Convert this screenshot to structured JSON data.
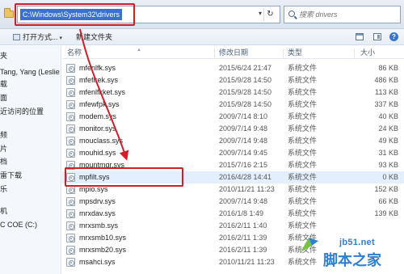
{
  "address": {
    "path": "C:\\Windows\\System32\\drivers",
    "dropdown_glyph": "▾",
    "refresh_glyph": "↻"
  },
  "search": {
    "placeholder": "搜索 drivers"
  },
  "toolbar": {
    "open_label": "打开方式...",
    "open_caret": "▾",
    "new_folder_label": "新建文件夹",
    "help_glyph": "?"
  },
  "nav": {
    "items": [
      "夹",
      "Tang, Yang (Leslie",
      "载",
      "面",
      "近访问的位置",
      "",
      "频",
      "片",
      "档",
      "雷下载",
      "乐",
      "",
      "机",
      "C COE (C:)"
    ]
  },
  "columns": {
    "name": "名称",
    "date": "修改日期",
    "type": "类型",
    "size": "大小"
  },
  "files": [
    {
      "name": "mfenlfk.sys",
      "date": "2015/6/24 21:47",
      "type": "系统文件",
      "size": "86 KB"
    },
    {
      "name": "mfefirek.sys",
      "date": "2015/9/28 14:50",
      "type": "系统文件",
      "size": "486 KB"
    },
    {
      "name": "mfenlfkket.sys",
      "date": "2015/9/28 14:50",
      "type": "系统文件",
      "size": "113 KB"
    },
    {
      "name": "mfewfpk.sys",
      "date": "2015/9/28 14:50",
      "type": "系统文件",
      "size": "337 KB"
    },
    {
      "name": "modem.sys",
      "date": "2009/7/14 8:10",
      "type": "系统文件",
      "size": "40 KB"
    },
    {
      "name": "monitor.sys",
      "date": "2009/7/14 9:48",
      "type": "系统文件",
      "size": "24 KB"
    },
    {
      "name": "mouclass.sys",
      "date": "2009/7/14 9:48",
      "type": "系统文件",
      "size": "49 KB"
    },
    {
      "name": "mouhid.sys",
      "date": "2009/7/14 9:45",
      "type": "系统文件",
      "size": "31 KB"
    },
    {
      "name": "mountmgr.sys",
      "date": "2015/7/16 2:15",
      "type": "系统文件",
      "size": "93 KB"
    },
    {
      "name": "mpfilt.sys",
      "date": "2016/4/28 14:41",
      "type": "系统文件",
      "size": "0 KB"
    },
    {
      "name": "mpio.sys",
      "date": "2010/11/21 11:23",
      "type": "系统文件",
      "size": "152 KB"
    },
    {
      "name": "mpsdrv.sys",
      "date": "2009/7/14 9:48",
      "type": "系统文件",
      "size": "66 KB"
    },
    {
      "name": "mrxdav.sys",
      "date": "2016/1/8 1:49",
      "type": "系统文件",
      "size": "139 KB"
    },
    {
      "name": "mrxsmb.sys",
      "date": "2016/2/11 1:40",
      "type": "系统文件",
      "size": ""
    },
    {
      "name": "mrxsmb10.sys",
      "date": "2016/2/11 1:39",
      "type": "系统文件",
      "size": ""
    },
    {
      "name": "mrxsmb20.sys",
      "date": "2016/2/11 1:39",
      "type": "系统文件",
      "size": ""
    },
    {
      "name": "msahci.sys",
      "date": "2010/11/21 11:23",
      "type": "系统文件",
      "size": ""
    }
  ],
  "watermark": {
    "url": "jb51.net",
    "text": "脚本之家"
  },
  "colors": {
    "annotation_red": "#d11f2a",
    "address_highlight": "#3b6fd0",
    "selected_row": "#e3efff",
    "watermark_blue": "#2e7fd2"
  }
}
